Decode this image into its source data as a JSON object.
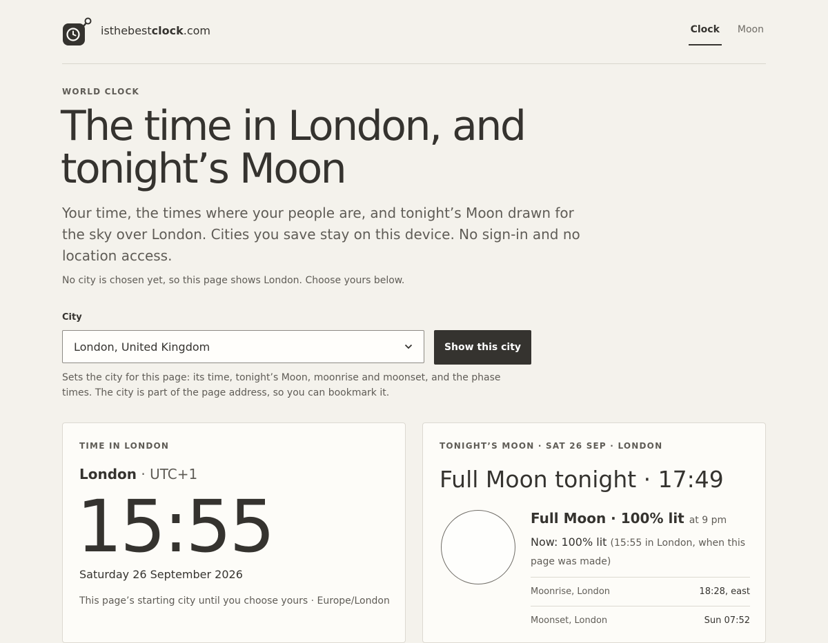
{
  "header": {
    "brand_prefix": "isthebest",
    "brand_bold": "clock",
    "brand_suffix": ".com",
    "nav": [
      {
        "label": "Clock",
        "active": true
      },
      {
        "label": "Moon",
        "active": false
      }
    ]
  },
  "hero": {
    "eyebrow": "WORLD CLOCK",
    "title": "The time in London, and tonight’s Moon",
    "lede": "Your time, the times where your people are, and tonight’s Moon drawn for the sky over London. Cities you save stay on this device. No sign-in and no location access.",
    "note": "No city is chosen yet, so this page shows London. Choose yours below."
  },
  "city_form": {
    "label": "City",
    "selected": "London, United Kingdom",
    "button": "Show this city",
    "help": "Sets the city for this page: its time, tonight’s Moon, moonrise and moonset, and the phase times. The city is part of the page address, so you can bookmark it."
  },
  "time_card": {
    "eyebrow": "TIME IN LONDON",
    "city": "London",
    "offset": " · UTC+1",
    "time": "15:55",
    "date": "Saturday 26 September 2026",
    "starting": "This page’s starting city until you choose yours · Europe/London"
  },
  "moon_card": {
    "eyebrow": "TONIGHT’S MOON · SAT 26 SEP · LONDON",
    "title": "Full Moon tonight · 17:49",
    "phase": "Full Moon · 100% lit",
    "phase_note": "at 9 pm",
    "now": "Now: 100% lit",
    "now_note": "(15:55 in London, when this page was made)",
    "rows": [
      {
        "label": "Moonrise, London",
        "value": "18:28, east"
      },
      {
        "label": "Moonset, London",
        "value": "Sun 07:52"
      }
    ]
  },
  "colors": {
    "background": "#f4f2ec",
    "text": "#35332f",
    "button": "#35332f"
  }
}
